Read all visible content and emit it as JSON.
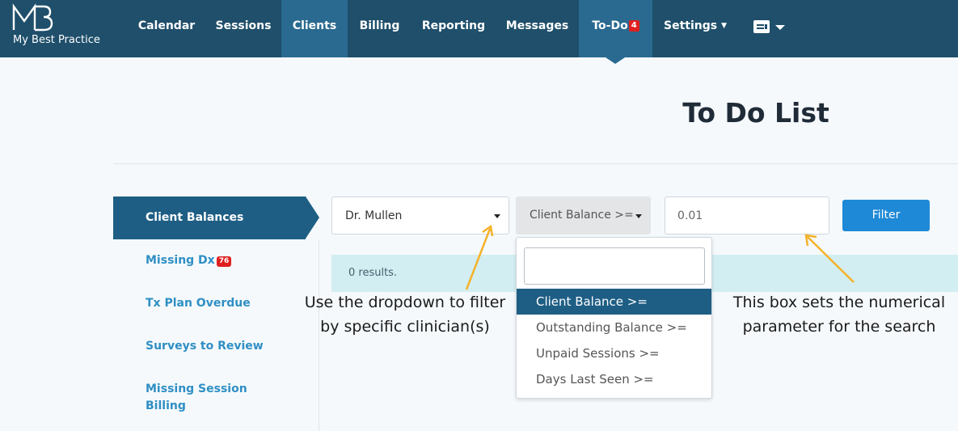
{
  "brand": {
    "logo_mark": "MB",
    "name": "My Best Practice"
  },
  "nav": {
    "items": [
      {
        "label": "Calendar"
      },
      {
        "label": "Sessions"
      },
      {
        "label": "Clients"
      },
      {
        "label": "Billing"
      },
      {
        "label": "Reporting"
      },
      {
        "label": "Messages"
      },
      {
        "label": "To-Do"
      },
      {
        "label": "Settings"
      }
    ],
    "todo_count": "4",
    "active": [
      "Clients",
      "To-Do"
    ],
    "profile_icon": "id-card-icon"
  },
  "page": {
    "title": "To Do List"
  },
  "sidebar": {
    "items": [
      {
        "label": "Client Balances",
        "active": true
      },
      {
        "label": "Missing Dx",
        "badge": "76"
      },
      {
        "label": "Tx Plan Overdue"
      },
      {
        "label": "Surveys to Review"
      },
      {
        "label": "Missing Session Billing"
      }
    ]
  },
  "filters": {
    "clinician": "Dr. Mullen",
    "type": "Client Balance >=",
    "amount": "0.01",
    "filter_label": "Filter",
    "results": "0 results."
  },
  "dropdown": {
    "search_value": "",
    "options": [
      {
        "label": "Client Balance >=",
        "selected": true
      },
      {
        "label": "Outstanding Balance >="
      },
      {
        "label": "Unpaid Sessions >="
      },
      {
        "label": "Days Last Seen >="
      }
    ]
  },
  "annotations": {
    "left_line1": "Use the dropdown to filter",
    "left_line2": "by specific clinician(s)",
    "right_line1": "This box sets the numerical",
    "right_line2": "parameter for the search",
    "arrow_color": "#f4b22a"
  },
  "colors": {
    "nav_bg": "#1f4f6b",
    "nav_active": "#2a6a90",
    "accent": "#1e5e84",
    "badge": "#e0201f",
    "button": "#1e89d6"
  }
}
